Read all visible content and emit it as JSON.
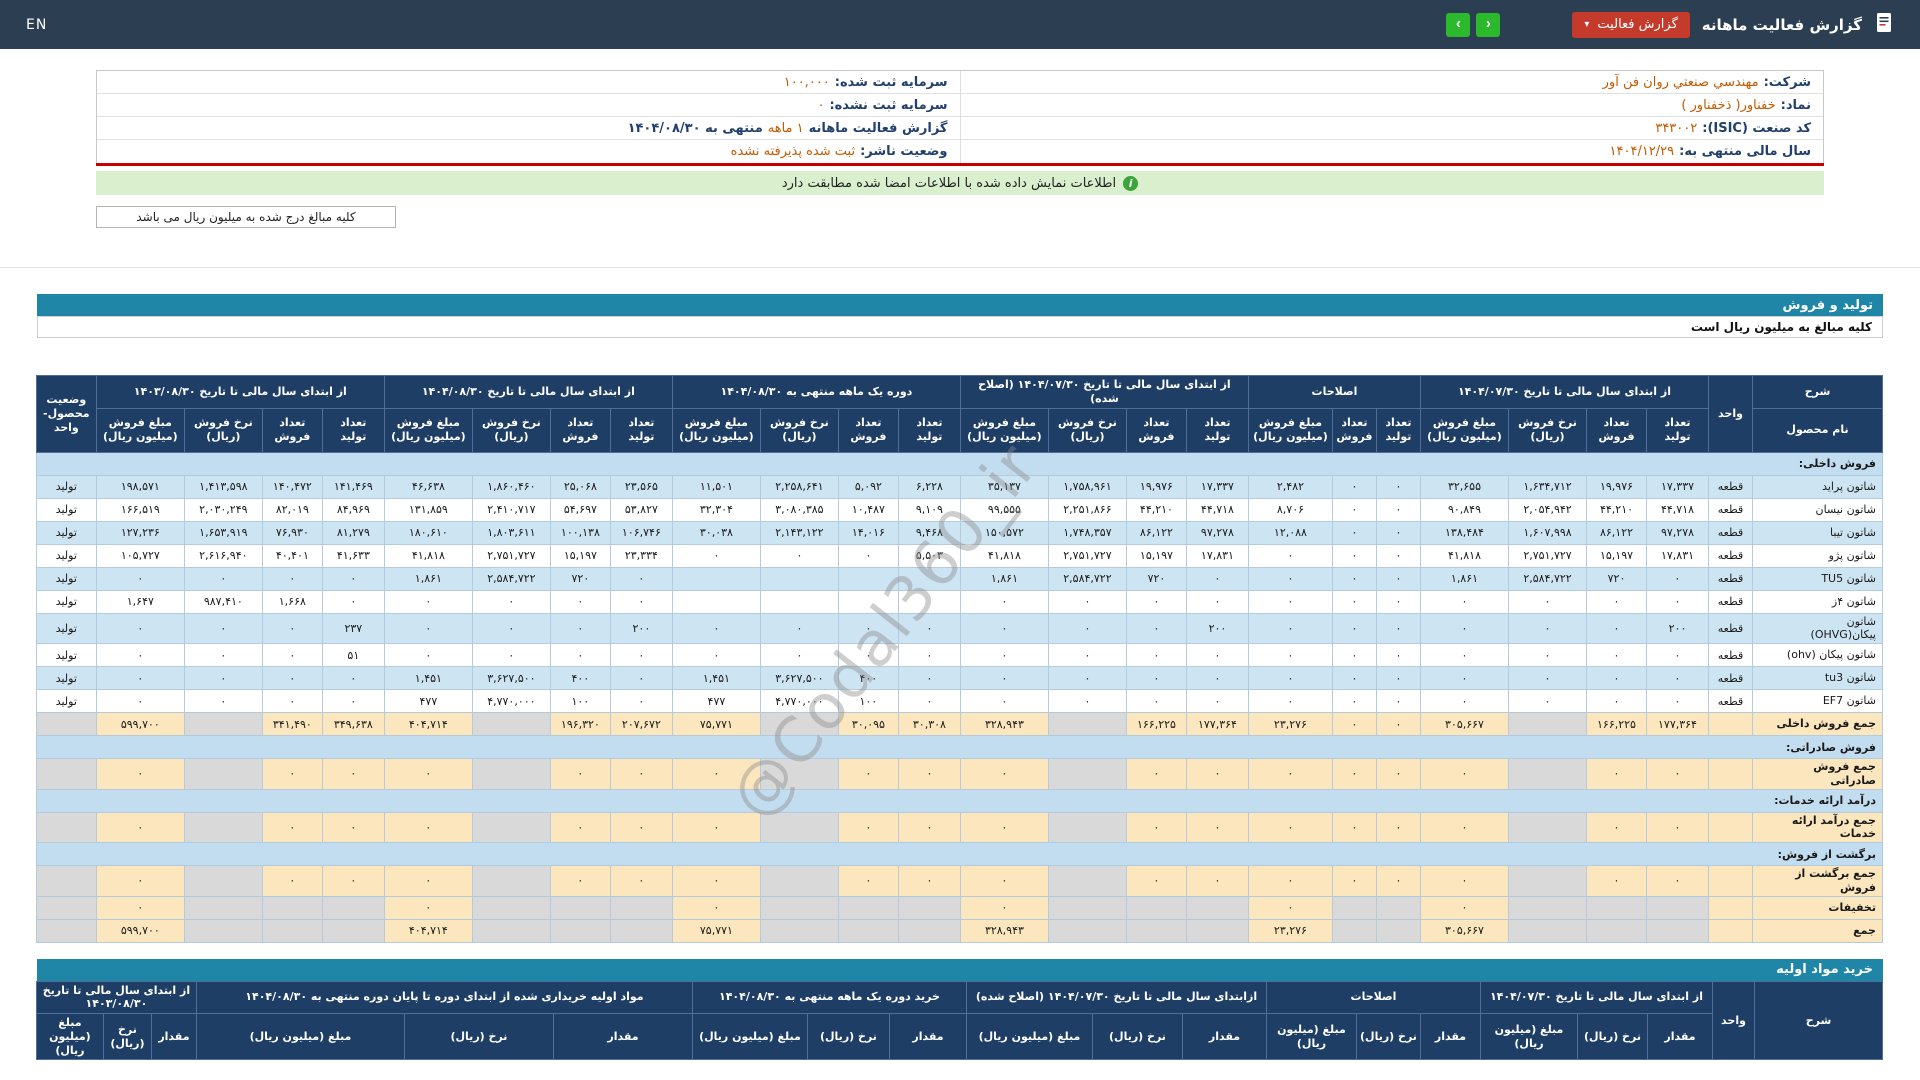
{
  "topbar": {
    "en": "EN",
    "title": "گزارش فعالیت ماهانه",
    "report_button": "گزارش فعالیت",
    "caret": "▾",
    "nav_right": "›",
    "nav_left": "‹"
  },
  "company_info": {
    "right": [
      {
        "label": "شرکت:",
        "value": "مهندسي صنعتي روان فن آور"
      },
      {
        "label": "نماد:",
        "value": "خفناور( ذخفناور )"
      },
      {
        "label": "کد صنعت (ISIC):",
        "value": "۳۴۳۰۰۲"
      },
      {
        "label": "سال مالی منتهی به:",
        "value": "۱۴۰۴/۱۲/۲۹"
      }
    ],
    "left": [
      {
        "label": "سرمایه ثبت شده:",
        "value": "۱۰۰,۰۰۰"
      },
      {
        "label": "سرمایه ثبت نشده:",
        "value": "۰"
      },
      {
        "label": "گزارش فعالیت ماهانه",
        "value": "۱ ماهه",
        "suffix": "منتهی به ۱۴۰۴/۰۸/۳۰"
      },
      {
        "label": "وضعیت ناشر:",
        "value": "ثبت شده پذیرفته نشده"
      }
    ]
  },
  "banner": {
    "icon": "i",
    "text": "اطلاعات نمایش داده شده با اطلاعات امضا شده مطابقت دارد"
  },
  "amounts_note": "کلیه مبالغ درج شده به میلیون ریال می باشد",
  "watermark": "@Codal360_ir",
  "colors": {
    "topbar": "#2c3e52",
    "section_bar": "#1f86a8",
    "table_header": "#1e3e66",
    "row_blue": "#cde4f3",
    "total_yellow": "#fbe6bd",
    "disabled_gray": "#d9d9d9",
    "value_orange": "#c25a00",
    "red_line": "#c40000",
    "banner_green": "#d9efce",
    "button_red": "#c43a2b",
    "button_green": "#2db92d"
  },
  "sales_section": {
    "title": "تولید و فروش",
    "note": "کلیه مبالغ به میلیون ریال است"
  },
  "sales_table": {
    "scope_header": "شرح",
    "product_header": "نام محصول",
    "unit_header": "واحد",
    "status_header": "وضعیت\nمحصول-واحد",
    "groups": [
      {
        "title": "از ابتدای سال مالی تا تاریخ ۱۴۰۴/۰۷/۳۰",
        "cols": [
          "تعداد\nتولید",
          "تعداد\nفروش",
          "نرخ فروش\n(ریال)",
          "مبلغ فروش\n(میلیون ریال)"
        ]
      },
      {
        "title": "اصلاحات",
        "cols": [
          "تعداد\nتولید",
          "تعداد\nفروش",
          "مبلغ فروش\n(میلیون ریال)"
        ]
      },
      {
        "title": "از ابتدای سال مالی تا تاریخ ۱۴۰۴/۰۷/۳۰ (اصلاح شده)",
        "cols": [
          "تعداد\nتولید",
          "تعداد\nفروش",
          "نرخ فروش\n(ریال)",
          "مبلغ فروش\n(میلیون ریال)"
        ]
      },
      {
        "title": "دوره یک ماهه منتهی به ۱۴۰۴/۰۸/۳۰",
        "cols": [
          "تعداد\nتولید",
          "تعداد\nفروش",
          "نرخ فروش\n(ریال)",
          "مبلغ فروش\n(میلیون ریال)"
        ]
      },
      {
        "title": "از ابتدای سال مالی تا تاریخ ۱۴۰۴/۰۸/۳۰",
        "cols": [
          "تعداد\nتولید",
          "تعداد\nفروش",
          "نرخ فروش\n(ریال)",
          "مبلغ فروش\n(میلیون ریال)"
        ]
      },
      {
        "title": "از ابتدای سال مالی تا تاریخ ۱۴۰۳/۰۸/۳۰",
        "cols": [
          "تعداد\nتولید",
          "تعداد\nفروش",
          "نرخ فروش\n(ریال)",
          "مبلغ فروش\n(میلیون ریال)"
        ]
      }
    ],
    "rows": [
      {
        "type": "section",
        "label": "فروش داخلی:"
      },
      {
        "type": "product",
        "name": "شاتون پراید",
        "unit": "قطعه",
        "status": "تولید",
        "cells": [
          "۱۷,۳۳۷",
          "۱۹,۹۷۶",
          "۱,۶۳۴,۷۱۲",
          "۳۲,۶۵۵",
          "۰",
          "۰",
          "۲,۴۸۲",
          "۱۷,۳۳۷",
          "۱۹,۹۷۶",
          "۱,۷۵۸,۹۶۱",
          "۳۵,۱۳۷",
          "۶,۲۲۸",
          "۵,۰۹۲",
          "۲,۲۵۸,۶۴۱",
          "۱۱,۵۰۱",
          "۲۳,۵۶۵",
          "۲۵,۰۶۸",
          "۱,۸۶۰,۴۶۰",
          "۴۶,۶۳۸",
          "۱۴۱,۴۶۹",
          "۱۴۰,۴۷۲",
          "۱,۴۱۳,۵۹۸",
          "۱۹۸,۵۷۱"
        ]
      },
      {
        "type": "product",
        "name": "شاتون نیسان",
        "unit": "قطعه",
        "status": "تولید",
        "cells": [
          "۴۴,۷۱۸",
          "۴۴,۲۱۰",
          "۲,۰۵۴,۹۴۲",
          "۹۰,۸۴۹",
          "۰",
          "۰",
          "۸,۷۰۶",
          "۴۴,۷۱۸",
          "۴۴,۲۱۰",
          "۲,۲۵۱,۸۶۶",
          "۹۹,۵۵۵",
          "۹,۱۰۹",
          "۱۰,۴۸۷",
          "۳,۰۸۰,۳۸۵",
          "۳۲,۳۰۴",
          "۵۳,۸۲۷",
          "۵۴,۶۹۷",
          "۲,۴۱۰,۷۱۷",
          "۱۳۱,۸۵۹",
          "۸۴,۹۶۹",
          "۸۲,۰۱۹",
          "۲,۰۳۰,۲۴۹",
          "۱۶۶,۵۱۹"
        ]
      },
      {
        "type": "product",
        "name": "شاتون تیبا",
        "unit": "قطعه",
        "status": "تولید",
        "cells": [
          "۹۷,۲۷۸",
          "۸۶,۱۲۲",
          "۱,۶۰۷,۹۹۸",
          "۱۳۸,۴۸۴",
          "۰",
          "۰",
          "۱۲,۰۸۸",
          "۹۷,۲۷۸",
          "۸۶,۱۲۲",
          "۱,۷۴۸,۳۵۷",
          "۱۵۰,۵۷۲",
          "۹,۴۶۸",
          "۱۴,۰۱۶",
          "۲,۱۴۳,۱۲۲",
          "۳۰,۰۳۸",
          "۱۰۶,۷۴۶",
          "۱۰۰,۱۳۸",
          "۱,۸۰۳,۶۱۱",
          "۱۸۰,۶۱۰",
          "۸۱,۲۷۹",
          "۷۶,۹۳۰",
          "۱,۶۵۳,۹۱۹",
          "۱۲۷,۲۳۶"
        ]
      },
      {
        "type": "product",
        "name": "شاتون پژو",
        "unit": "قطعه",
        "status": "تولید",
        "cells": [
          "۱۷,۸۳۱",
          "۱۵,۱۹۷",
          "۲,۷۵۱,۷۲۷",
          "۴۱,۸۱۸",
          "۰",
          "۰",
          "۰",
          "۱۷,۸۳۱",
          "۱۵,۱۹۷",
          "۲,۷۵۱,۷۲۷",
          "۴۱,۸۱۸",
          "۵,۵۰۳",
          "۰",
          "۰",
          "۰",
          "۲۳,۳۳۴",
          "۱۵,۱۹۷",
          "۲,۷۵۱,۷۲۷",
          "۴۱,۸۱۸",
          "۴۱,۶۳۳",
          "۴۰,۴۰۱",
          "۲,۶۱۶,۹۴۰",
          "۱۰۵,۷۲۷"
        ]
      },
      {
        "type": "product",
        "name": "شاتون TU5",
        "unit": "قطعه",
        "status": "تولید",
        "cells": [
          "۰",
          "۷۲۰",
          "۲,۵۸۴,۷۲۲",
          "۱,۸۶۱",
          "۰",
          "۰",
          "۰",
          "۰",
          "۷۲۰",
          "۲,۵۸۴,۷۲۲",
          "۱,۸۶۱",
          "",
          "",
          "",
          "",
          "۰",
          "۷۲۰",
          "۲,۵۸۴,۷۲۲",
          "۱,۸۶۱",
          "۰",
          "۰",
          "۰",
          "۰"
        ]
      },
      {
        "type": "product",
        "name": "شاتون ۴ز",
        "unit": "قطعه",
        "status": "تولید",
        "cells": [
          "۰",
          "۰",
          "۰",
          "۰",
          "۰",
          "۰",
          "۰",
          "۰",
          "۰",
          "۰",
          "۰",
          "",
          "",
          "",
          "",
          "۰",
          "۰",
          "۰",
          "۰",
          "۰",
          "۱,۶۶۸",
          "۹۸۷,۴۱۰",
          "۱,۶۴۷"
        ]
      },
      {
        "type": "product",
        "name": "شاتون\nپیکان(OHVG)",
        "unit": "قطعه",
        "status": "تولید",
        "cells": [
          "۲۰۰",
          "۰",
          "۰",
          "۰",
          "۰",
          "۰",
          "۰",
          "۲۰۰",
          "۰",
          "۰",
          "۰",
          "۰",
          "۰",
          "۰",
          "۰",
          "۲۰۰",
          "۰",
          "۰",
          "۰",
          "۲۳۷",
          "۰",
          "۰",
          "۰"
        ]
      },
      {
        "type": "product",
        "name": "شاتون پیکان (ohv)",
        "unit": "قطعه",
        "status": "تولید",
        "cells": [
          "۰",
          "۰",
          "۰",
          "۰",
          "۰",
          "۰",
          "۰",
          "۰",
          "۰",
          "۰",
          "۰",
          "۰",
          "۰",
          "۰",
          "۰",
          "۰",
          "۰",
          "۰",
          "۰",
          "۵۱",
          "۰",
          "۰",
          "۰"
        ]
      },
      {
        "type": "product",
        "name": "شاتون tu3",
        "unit": "قطعه",
        "status": "تولید",
        "cells": [
          "۰",
          "۰",
          "۰",
          "۰",
          "۰",
          "۰",
          "۰",
          "۰",
          "۰",
          "۰",
          "۰",
          "۰",
          "۴۰۰",
          "۳,۶۲۷,۵۰۰",
          "۱,۴۵۱",
          "۰",
          "۴۰۰",
          "۳,۶۲۷,۵۰۰",
          "۱,۴۵۱",
          "۰",
          "۰",
          "۰",
          "۰"
        ]
      },
      {
        "type": "product",
        "name": "شاتون EF7",
        "unit": "قطعه",
        "status": "تولید",
        "cells": [
          "۰",
          "۰",
          "۰",
          "۰",
          "۰",
          "۰",
          "۰",
          "۰",
          "۰",
          "۰",
          "۰",
          "۰",
          "۱۰۰",
          "۴,۷۷۰,۰۰۰",
          "۴۷۷",
          "۰",
          "۱۰۰",
          "۴,۷۷۰,۰۰۰",
          "۴۷۷",
          "۰",
          "۰",
          "۰",
          "۰"
        ]
      },
      {
        "type": "total",
        "name": "جمع فروش داخلی",
        "cells": [
          "۱۷۷,۳۶۴",
          "۱۶۶,۲۲۵",
          null,
          "۳۰۵,۶۶۷",
          "۰",
          "۰",
          "۲۳,۲۷۶",
          "۱۷۷,۳۶۴",
          "۱۶۶,۲۲۵",
          null,
          "۳۲۸,۹۴۳",
          "۳۰,۳۰۸",
          "۳۰,۰۹۵",
          null,
          "۷۵,۷۷۱",
          "۲۰۷,۶۷۲",
          "۱۹۶,۳۲۰",
          null,
          "۴۰۴,۷۱۴",
          "۳۴۹,۶۳۸",
          "۳۴۱,۴۹۰",
          null,
          "۵۹۹,۷۰۰"
        ]
      },
      {
        "type": "section",
        "label": "فروش صادراتی:"
      },
      {
        "type": "total",
        "name": "جمع فروش\nصادراتی",
        "cells": [
          "۰",
          "۰",
          null,
          "۰",
          "۰",
          "۰",
          "۰",
          "۰",
          "۰",
          null,
          "۰",
          "۰",
          "۰",
          null,
          "۰",
          "۰",
          "۰",
          null,
          "۰",
          "۰",
          "۰",
          null,
          "۰"
        ]
      },
      {
        "type": "section",
        "label": "درآمد ارائه خدمات:"
      },
      {
        "type": "total",
        "name": "جمع درآمد ارائه\nخدمات",
        "cells": [
          "۰",
          "۰",
          null,
          "۰",
          "۰",
          "۰",
          "۰",
          "۰",
          "۰",
          null,
          "۰",
          "۰",
          "۰",
          null,
          "۰",
          "۰",
          "۰",
          null,
          "۰",
          "۰",
          "۰",
          null,
          "۰"
        ]
      },
      {
        "type": "section",
        "label": "برگشت از فروش:"
      },
      {
        "type": "total",
        "name": "جمع برگشت از\nفروش",
        "cells": [
          "۰",
          "۰",
          null,
          "۰",
          "۰",
          "۰",
          "۰",
          "۰",
          "۰",
          null,
          "۰",
          "۰",
          "۰",
          null,
          "۰",
          "۰",
          "۰",
          null,
          "۰",
          "۰",
          "۰",
          null,
          "۰"
        ]
      },
      {
        "type": "total",
        "name": "تخفیفات",
        "cells": [
          null,
          null,
          null,
          "۰",
          null,
          null,
          "۰",
          null,
          null,
          null,
          "۰",
          null,
          null,
          null,
          "۰",
          null,
          null,
          null,
          "۰",
          null,
          null,
          null,
          "۰"
        ]
      },
      {
        "type": "total",
        "name": "جمع",
        "cells": [
          null,
          null,
          null,
          "۳۰۵,۶۶۷",
          null,
          null,
          "۲۳,۲۷۶",
          null,
          null,
          null,
          "۳۲۸,۹۴۳",
          null,
          null,
          null,
          "۷۵,۷۷۱",
          null,
          null,
          null,
          "۴۰۴,۷۱۴",
          null,
          null,
          null,
          "۵۹۹,۷۰۰"
        ]
      }
    ]
  },
  "purchase_section": {
    "title": "خرید مواد اولیه"
  },
  "purchase_table": {
    "scope_header": "شرح",
    "unit_header": "واحد",
    "groups": [
      {
        "title": "از ابتدای سال مالی تا تاریخ ۱۴۰۴/۰۷/۳۰"
      },
      {
        "title": "اصلاحات"
      },
      {
        "title": "ازابتدای سال مالی تا تاریخ ۱۴۰۴/۰۷/۳۰ (اصلاح شده)"
      },
      {
        "title": "خرید دوره یک ماهه منتهی به ۱۴۰۴/۰۸/۳۰"
      },
      {
        "title": "مواد اولیه خریداری شده از ابتدای دوره تا پایان دوره منتهی به ۱۴۰۴/۰۸/۳۰"
      },
      {
        "title": "از ابتدای سال مالی تا تاریخ ۱۴۰۳/۰۸/۳۰"
      }
    ],
    "subcols": [
      "مقدار",
      "نرخ (ریال)",
      "مبلغ (میلیون ریال)"
    ]
  }
}
